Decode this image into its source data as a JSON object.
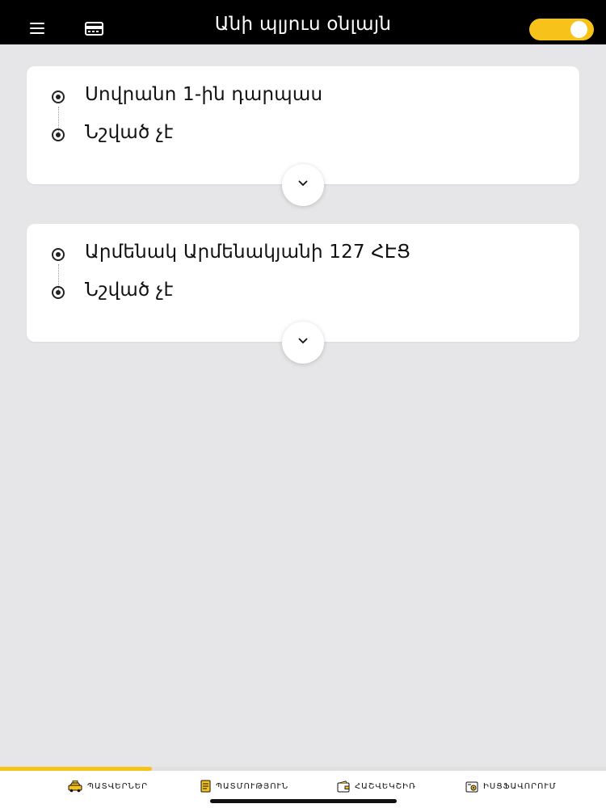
{
  "header": {
    "title": "Անի պլյուս օնլայն"
  },
  "icons": {
    "menu": "menu-icon",
    "card": "card-icon",
    "expand": "chevron-down-icon",
    "taxi": "taxi-icon",
    "history": "document-icon",
    "wallet": "wallet-icon",
    "settings": "settings-icon"
  },
  "colors": {
    "accent": "#f7c31a",
    "header_bg": "#000000",
    "page_bg": "#e6e5e7"
  },
  "orders": [
    {
      "from": "Սովրանո 1-ին դարպաս",
      "to": "Նշված չէ"
    },
    {
      "from": "Արմենակ Արմենակյանի  127  ՀԷՑ",
      "to": "Նշված չէ"
    }
  ],
  "progress": {
    "fraction": 0.25
  },
  "tabs": [
    {
      "label": "ՊԱՏՎԵՐՆԵՐ"
    },
    {
      "label": "ՊԱՏՄՈՒԹՅՈՒՆ"
    },
    {
      "label": "ՀԱՇՎԵԿՇԻՌ"
    },
    {
      "label": "ԻՍՑՖԱՎՈՐՈՒՄ"
    }
  ]
}
